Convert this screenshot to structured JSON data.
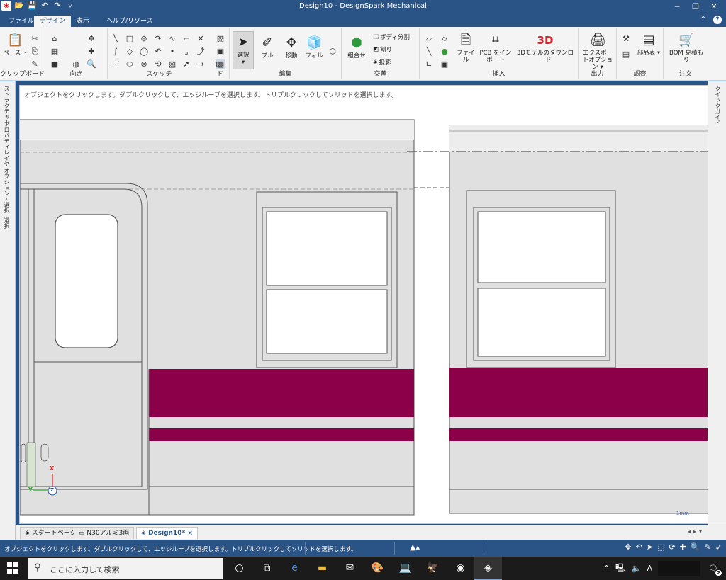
{
  "window": {
    "title": "Design10 - DesignSpark Mechanical"
  },
  "tabs": [
    {
      "label": "ファイル"
    },
    {
      "label": "デザイン"
    },
    {
      "label": "表示"
    },
    {
      "label": "ヘルプ/リソース"
    }
  ],
  "ribbon": {
    "groups": {
      "clipboard": "クリップボード",
      "orient": "向き",
      "sketch": "スケッチ",
      "mode": "モード",
      "edit": "編集",
      "intersect": "交差",
      "insert": "挿入",
      "output": "出力",
      "inspect": "調査",
      "order": "注文"
    },
    "buttons": {
      "paste": "ペースト",
      "select": "選択",
      "pull": "プル",
      "move": "移動",
      "fill": "フィル",
      "combine": "組合せ",
      "split_body": "ボディ分割",
      "split": "割り",
      "project": "投影",
      "file": "ファイル",
      "pcb_import": "PCB をインポート",
      "download_3d": "3Dモデルのダウンロード",
      "export_options": "エクスポートオプション",
      "parts_table": "部品表",
      "bom_quote": "BOM 見積もり",
      "badge_3d": "3D"
    }
  },
  "side_panels": {
    "left": [
      "ストラクチャー",
      "プロパティ",
      "レイヤ",
      "オプション - 選択",
      "選択"
    ],
    "right": [
      "クイックガイド"
    ]
  },
  "canvas": {
    "hint": "オブジェクトをクリックします。ダブルクリックして、エッジループを選択します。トリプルクリックしてソリッドを選択します。",
    "scale_label": "1mm",
    "triad": {
      "x": "X",
      "y": "Y",
      "z": "Z"
    },
    "colors": {
      "stripe": "#8b0048",
      "body": "#e0e0e0",
      "window": "#ffffff"
    }
  },
  "doc_tabs": [
    {
      "label": "スタートページ"
    },
    {
      "label": "N30アルミ3両"
    },
    {
      "label": "Design10*"
    }
  ],
  "status": {
    "message": "オブジェクトをクリックします。ダブルクリックして、エッジループを選択します。トリプルクリックしてソリッドを選択します。"
  },
  "taskbar": {
    "search_placeholder": "ここに入力して検索",
    "ime": "A",
    "notifications": "2"
  }
}
